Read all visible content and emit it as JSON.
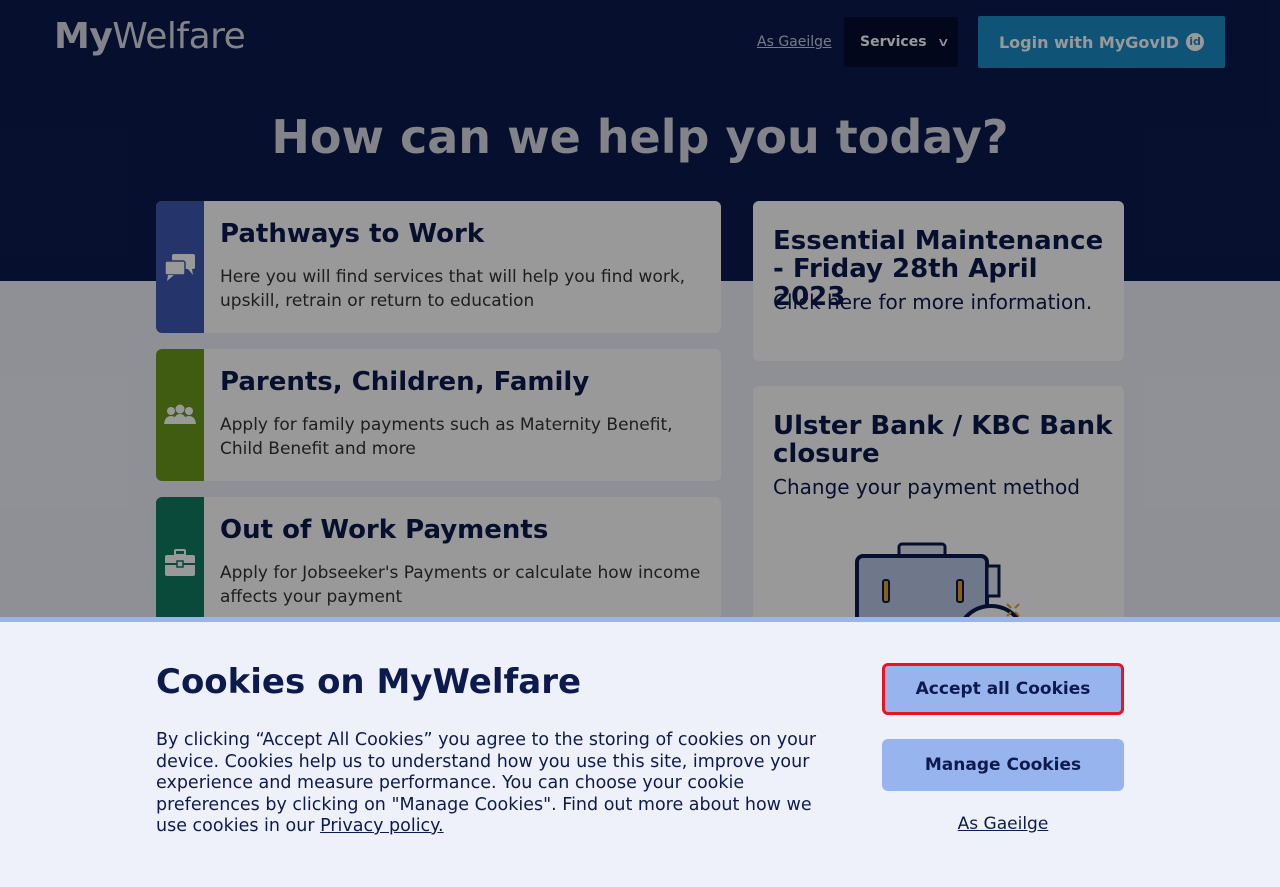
{
  "header": {
    "logo_bold": "My",
    "logo_light": "Welfare",
    "language_link": "As Gaeilge",
    "services_label": "Services",
    "login_label": "Login with MyGovID",
    "login_badge": "id"
  },
  "hero": {
    "title": "How can we help you today?"
  },
  "cards": [
    {
      "title": "Pathways to Work",
      "description": "Here you will find services that will help you find work, upskill, retrain or return to education",
      "icon": "speech-bubbles-icon",
      "color": "#3f57b3"
    },
    {
      "title": "Parents, Children, Family",
      "description": "Apply for family payments such as Maternity Benefit, Child Benefit and more",
      "icon": "family-icon",
      "color": "#6a9a1c"
    },
    {
      "title": "Out of Work Payments",
      "description": "Apply for Jobseeker's Payments or calculate how income affects your payment",
      "icon": "briefcase-icon",
      "color": "#0f7c62"
    }
  ],
  "notices": [
    {
      "title": "Essential Maintenance - Friday 28th April 2023",
      "text": "Click here for more information."
    },
    {
      "title": "Ulster Bank / KBC Bank closure",
      "text": "Change your payment method",
      "image": "briefcase-illustration"
    }
  ],
  "cookies": {
    "title": "Cookies on MyWelfare",
    "body": "By clicking “Accept All Cookies” you agree to the storing of cookies on your device. Cookies help us to understand how you use this site, improve your experience and measure performance. You can choose your cookie preferences by clicking on \"Manage Cookies\". Find out more about how we use cookies in our ",
    "privacy_link": "Privacy policy.",
    "accept_label": "Accept all Cookies",
    "manage_label": "Manage Cookies",
    "language_link": "As Gaeilge"
  },
  "colors": {
    "navy": "#0c1a4e",
    "button_blue": "#98b4ee",
    "focus_red": "#e8141f",
    "login_blue": "#1a8bc6"
  }
}
